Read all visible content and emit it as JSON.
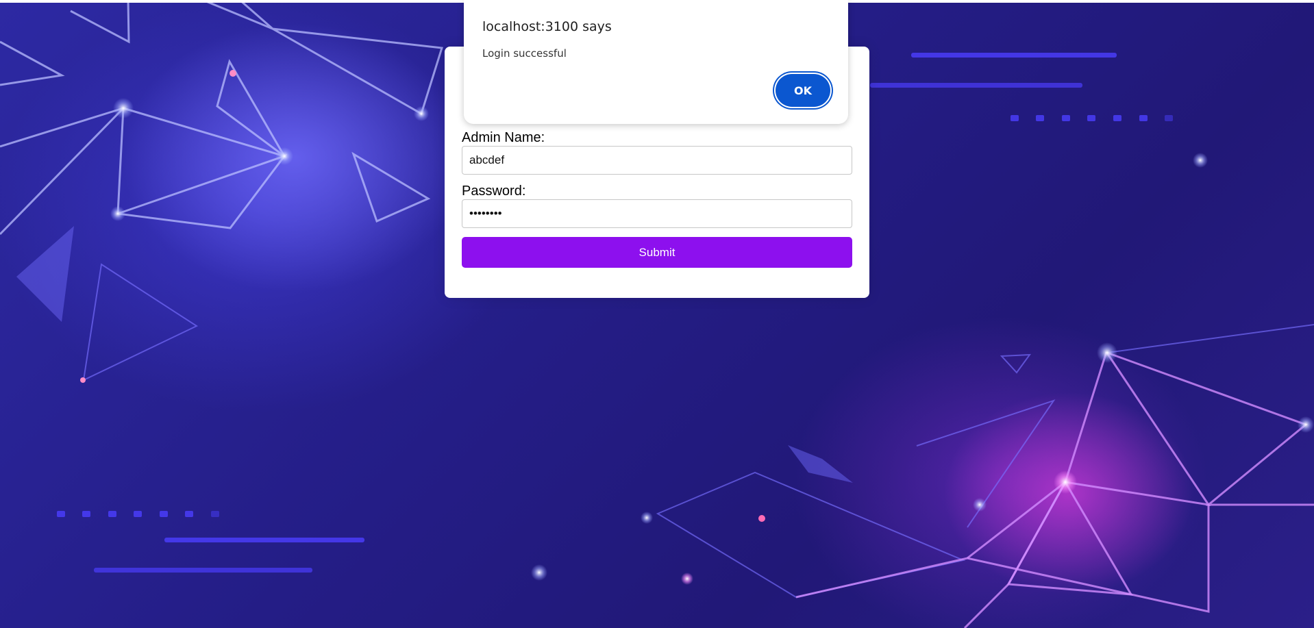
{
  "colors": {
    "background_accent": "#211a6e",
    "submit_button": "#8d10ee",
    "dialog_button": "#0b57d0"
  },
  "dialog": {
    "title": "localhost:3100 says",
    "message": "Login successful",
    "ok_label": "OK"
  },
  "login_form": {
    "admin_name_label": "Admin Name:",
    "admin_name_value": "abcdef",
    "password_label": "Password:",
    "password_value": "••••••••",
    "submit_label": "Submit"
  }
}
